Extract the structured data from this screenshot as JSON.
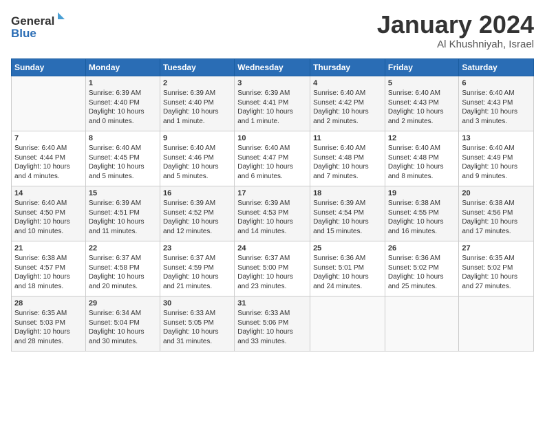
{
  "header": {
    "logo_line1": "General",
    "logo_line2": "Blue",
    "month": "January 2024",
    "location": "Al Khushniyah, Israel"
  },
  "columns": [
    "Sunday",
    "Monday",
    "Tuesday",
    "Wednesday",
    "Thursday",
    "Friday",
    "Saturday"
  ],
  "weeks": [
    [
      {
        "day": "",
        "content": ""
      },
      {
        "day": "1",
        "content": "Sunrise: 6:39 AM\nSunset: 4:40 PM\nDaylight: 10 hours\nand 0 minutes."
      },
      {
        "day": "2",
        "content": "Sunrise: 6:39 AM\nSunset: 4:40 PM\nDaylight: 10 hours\nand 1 minute."
      },
      {
        "day": "3",
        "content": "Sunrise: 6:39 AM\nSunset: 4:41 PM\nDaylight: 10 hours\nand 1 minute."
      },
      {
        "day": "4",
        "content": "Sunrise: 6:40 AM\nSunset: 4:42 PM\nDaylight: 10 hours\nand 2 minutes."
      },
      {
        "day": "5",
        "content": "Sunrise: 6:40 AM\nSunset: 4:43 PM\nDaylight: 10 hours\nand 2 minutes."
      },
      {
        "day": "6",
        "content": "Sunrise: 6:40 AM\nSunset: 4:43 PM\nDaylight: 10 hours\nand 3 minutes."
      }
    ],
    [
      {
        "day": "7",
        "content": "Sunrise: 6:40 AM\nSunset: 4:44 PM\nDaylight: 10 hours\nand 4 minutes."
      },
      {
        "day": "8",
        "content": "Sunrise: 6:40 AM\nSunset: 4:45 PM\nDaylight: 10 hours\nand 5 minutes."
      },
      {
        "day": "9",
        "content": "Sunrise: 6:40 AM\nSunset: 4:46 PM\nDaylight: 10 hours\nand 5 minutes."
      },
      {
        "day": "10",
        "content": "Sunrise: 6:40 AM\nSunset: 4:47 PM\nDaylight: 10 hours\nand 6 minutes."
      },
      {
        "day": "11",
        "content": "Sunrise: 6:40 AM\nSunset: 4:48 PM\nDaylight: 10 hours\nand 7 minutes."
      },
      {
        "day": "12",
        "content": "Sunrise: 6:40 AM\nSunset: 4:48 PM\nDaylight: 10 hours\nand 8 minutes."
      },
      {
        "day": "13",
        "content": "Sunrise: 6:40 AM\nSunset: 4:49 PM\nDaylight: 10 hours\nand 9 minutes."
      }
    ],
    [
      {
        "day": "14",
        "content": "Sunrise: 6:40 AM\nSunset: 4:50 PM\nDaylight: 10 hours\nand 10 minutes."
      },
      {
        "day": "15",
        "content": "Sunrise: 6:39 AM\nSunset: 4:51 PM\nDaylight: 10 hours\nand 11 minutes."
      },
      {
        "day": "16",
        "content": "Sunrise: 6:39 AM\nSunset: 4:52 PM\nDaylight: 10 hours\nand 12 minutes."
      },
      {
        "day": "17",
        "content": "Sunrise: 6:39 AM\nSunset: 4:53 PM\nDaylight: 10 hours\nand 14 minutes."
      },
      {
        "day": "18",
        "content": "Sunrise: 6:39 AM\nSunset: 4:54 PM\nDaylight: 10 hours\nand 15 minutes."
      },
      {
        "day": "19",
        "content": "Sunrise: 6:38 AM\nSunset: 4:55 PM\nDaylight: 10 hours\nand 16 minutes."
      },
      {
        "day": "20",
        "content": "Sunrise: 6:38 AM\nSunset: 4:56 PM\nDaylight: 10 hours\nand 17 minutes."
      }
    ],
    [
      {
        "day": "21",
        "content": "Sunrise: 6:38 AM\nSunset: 4:57 PM\nDaylight: 10 hours\nand 18 minutes."
      },
      {
        "day": "22",
        "content": "Sunrise: 6:37 AM\nSunset: 4:58 PM\nDaylight: 10 hours\nand 20 minutes."
      },
      {
        "day": "23",
        "content": "Sunrise: 6:37 AM\nSunset: 4:59 PM\nDaylight: 10 hours\nand 21 minutes."
      },
      {
        "day": "24",
        "content": "Sunrise: 6:37 AM\nSunset: 5:00 PM\nDaylight: 10 hours\nand 23 minutes."
      },
      {
        "day": "25",
        "content": "Sunrise: 6:36 AM\nSunset: 5:01 PM\nDaylight: 10 hours\nand 24 minutes."
      },
      {
        "day": "26",
        "content": "Sunrise: 6:36 AM\nSunset: 5:02 PM\nDaylight: 10 hours\nand 25 minutes."
      },
      {
        "day": "27",
        "content": "Sunrise: 6:35 AM\nSunset: 5:02 PM\nDaylight: 10 hours\nand 27 minutes."
      }
    ],
    [
      {
        "day": "28",
        "content": "Sunrise: 6:35 AM\nSunset: 5:03 PM\nDaylight: 10 hours\nand 28 minutes."
      },
      {
        "day": "29",
        "content": "Sunrise: 6:34 AM\nSunset: 5:04 PM\nDaylight: 10 hours\nand 30 minutes."
      },
      {
        "day": "30",
        "content": "Sunrise: 6:33 AM\nSunset: 5:05 PM\nDaylight: 10 hours\nand 31 minutes."
      },
      {
        "day": "31",
        "content": "Sunrise: 6:33 AM\nSunset: 5:06 PM\nDaylight: 10 hours\nand 33 minutes."
      },
      {
        "day": "",
        "content": ""
      },
      {
        "day": "",
        "content": ""
      },
      {
        "day": "",
        "content": ""
      }
    ]
  ]
}
